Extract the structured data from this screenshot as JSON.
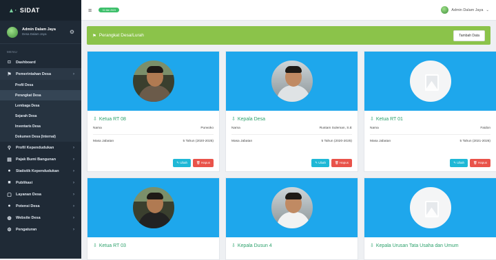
{
  "app": {
    "brand": "SIDAT",
    "brand_prefix": "▲·"
  },
  "user": {
    "name": "Admin Dalam Jaya",
    "role": "Desa Dalam Jaya"
  },
  "menu_header": "MENU",
  "sidebar": {
    "items": [
      {
        "label": "Dashboard",
        "icon": "◘"
      },
      {
        "label": "Pemerintahan Desa",
        "icon": "⚑",
        "arrow": "›"
      },
      {
        "label": "Profil Kependudukan",
        "icon": "⚲",
        "arrow": "›"
      },
      {
        "label": "Pajak Bumi Bangunan",
        "icon": "▤",
        "arrow": "›"
      },
      {
        "label": "Statistik Kependudukan",
        "icon": "●",
        "arrow": "›"
      },
      {
        "label": "Publikasi",
        "icon": "■",
        "arrow": "›"
      },
      {
        "label": "Layanan Desa",
        "icon": "▢",
        "arrow": "›"
      },
      {
        "label": "Potensi Desa",
        "icon": "●",
        "arrow": "›"
      },
      {
        "label": "Website Desa",
        "icon": "◍",
        "arrow": "›"
      },
      {
        "label": "Pengaturan",
        "icon": "⚙",
        "arrow": "›"
      }
    ],
    "subitems": [
      "Profil Desa",
      "Perangkat Desa",
      "Lembaga Desa",
      "Sejarah Desa",
      "Inventaris Desa",
      "Dokumen Desa (Internal)"
    ]
  },
  "topbar": {
    "pill": "31 Mei 2023",
    "user": "Admin Dalam Jaya"
  },
  "banner": {
    "title": "Perangkat Desa/Lurah",
    "add_button": "Tambah Data"
  },
  "labels": {
    "name": "Nama",
    "term": "Masa Jabatan",
    "edit": "Ubah",
    "delete": "Hapus"
  },
  "cards": [
    {
      "role": "Ketua RT 08",
      "name": "Purwoko",
      "term": "5 Tahun (2020-2025)"
    },
    {
      "role": "Kepala Desa",
      "name": "Rustam Suleman, S.E",
      "term": "5 Tahun (2020-2025)"
    },
    {
      "role": "Ketua RT 01",
      "name": "Faidon",
      "term": "5 Tahun (2021-2026)"
    },
    {
      "role": "Ketua RT 03"
    },
    {
      "role": "Kepala Dusun 4"
    },
    {
      "role": "Kepala Urusan Tata Usaha dan Umum"
    }
  ],
  "colors": {
    "accent": "#8bc34a",
    "hero": "#1ea7ec",
    "edit": "#1fb8d6",
    "delete": "#e9534a",
    "role": "#2aa06a"
  }
}
